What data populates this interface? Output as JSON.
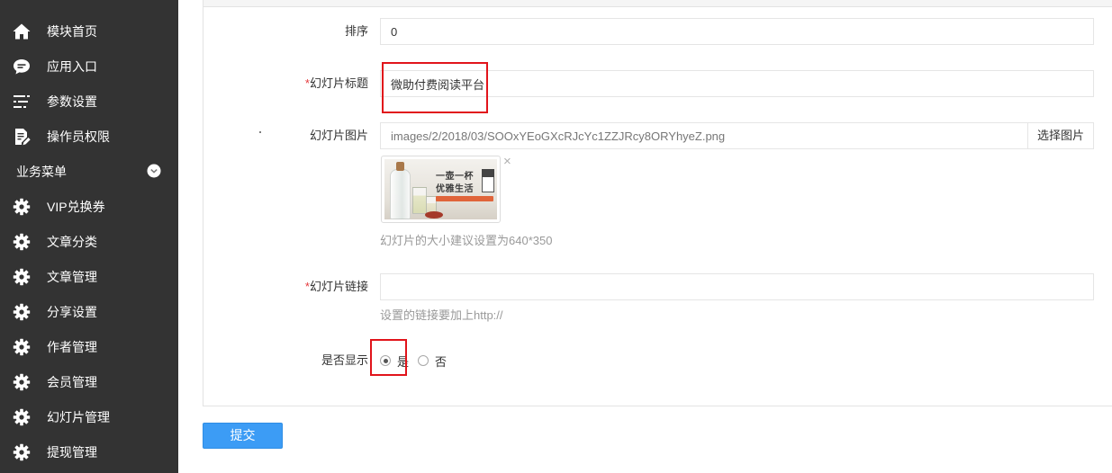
{
  "sidebar": {
    "items": [
      {
        "label": "模块首页",
        "icon": "home-icon"
      },
      {
        "label": "应用入口",
        "icon": "chat-icon"
      },
      {
        "label": "参数设置",
        "icon": "list-icon"
      },
      {
        "label": "操作员权限",
        "icon": "edit-document-icon"
      }
    ],
    "section": {
      "label": "业务菜单",
      "icon": "chevron-down-circle-icon"
    },
    "section_items": [
      {
        "label": "VIP兑换券",
        "icon": "gear-icon"
      },
      {
        "label": "文章分类",
        "icon": "gear-icon"
      },
      {
        "label": "文章管理",
        "icon": "gear-icon"
      },
      {
        "label": "分享设置",
        "icon": "gear-icon"
      },
      {
        "label": "作者管理",
        "icon": "gear-icon"
      },
      {
        "label": "会员管理",
        "icon": "gear-icon"
      },
      {
        "label": "幻灯片管理",
        "icon": "gear-icon"
      },
      {
        "label": "提现管理",
        "icon": "gear-icon"
      }
    ]
  },
  "form": {
    "sort": {
      "label": "排序",
      "value": "0"
    },
    "title": {
      "required_mark": "*",
      "label": "幻灯片标题",
      "value": "微助付费阅读平台"
    },
    "image": {
      "label": "幻灯片图片",
      "value": "images/2/2018/03/SOOxYEoGXcRJcYc1ZZJRcy8ORYhyeZ.png",
      "button": "选择图片",
      "remove": "×",
      "thumbnail": {
        "line1": "一壶一杯",
        "line2": "优雅生活"
      },
      "help": "幻灯片的大小建议设置为640*350"
    },
    "link": {
      "required_mark": "*",
      "label": "幻灯片链接",
      "value": "",
      "help": "设置的链接要加上http://"
    },
    "display": {
      "label": "是否显示",
      "options": [
        {
          "label": "是",
          "checked": true
        },
        {
          "label": "否",
          "checked": false
        }
      ]
    }
  },
  "submit": {
    "label": "提交"
  },
  "colors": {
    "sidebar_bg": "#333333",
    "primary_button": "#3c9cf5",
    "required_mark": "#e4393c",
    "highlight_box": "#e1141b"
  }
}
